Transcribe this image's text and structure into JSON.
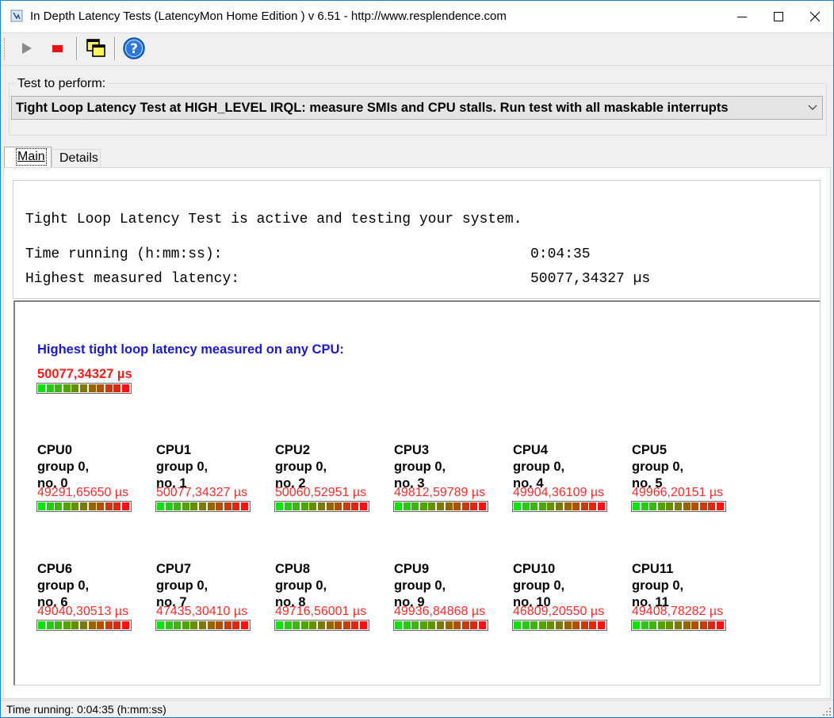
{
  "window": {
    "title": "In Depth Latency Tests  (LatencyMon Home Edition )  v 6.51 - http://www.resplendence.com"
  },
  "toolbar": {
    "icons": [
      "play-icon",
      "stop-icon",
      "windows-icon",
      "help-icon"
    ]
  },
  "test": {
    "group_label": "Test to perform:",
    "selected": "Tight Loop Latency Test at HIGH_LEVEL IRQL:  measure SMIs and CPU stalls. Run test with all maskable interrupts"
  },
  "tabs": [
    {
      "label": "Main"
    },
    {
      "label": "Details"
    }
  ],
  "summary": {
    "status": "Tight Loop Latency Test is active and testing your system.",
    "time_label": "Time running (h:mm:ss):",
    "time_value": "0:04:35",
    "latency_label": "Highest measured latency:",
    "latency_value": "50077,34327 µs"
  },
  "highest": {
    "label": "Highest tight loop latency measured on any CPU:",
    "value": "50077,34327 µs",
    "bar_level": 1.0
  },
  "cpus": [
    {
      "name": "CPU0",
      "group": "group 0,",
      "no": "no. 0",
      "value": "49291,65650 µs"
    },
    {
      "name": "CPU1",
      "group": "group 0,",
      "no": "no. 1",
      "value": "50077,34327 µs"
    },
    {
      "name": "CPU2",
      "group": "group 0,",
      "no": "no. 2",
      "value": "50060,52951 µs"
    },
    {
      "name": "CPU3",
      "group": "group 0,",
      "no": "no. 3",
      "value": "49812,59789 µs"
    },
    {
      "name": "CPU4",
      "group": "group 0,",
      "no": "no. 4",
      "value": "49904,36109 µs"
    },
    {
      "name": "CPU5",
      "group": "group 0,",
      "no": "no. 5",
      "value": "49966,20151 µs"
    },
    {
      "name": "CPU6",
      "group": "group 0,",
      "no": "no. 6",
      "value": "49040,30513 µs"
    },
    {
      "name": "CPU7",
      "group": "group 0,",
      "no": "no. 7",
      "value": "47435,30410 µs"
    },
    {
      "name": "CPU8",
      "group": "group 0,",
      "no": "no. 8",
      "value": "49716,56001 µs"
    },
    {
      "name": "CPU9",
      "group": "group 0,",
      "no": "no. 9",
      "value": "49936,84868 µs"
    },
    {
      "name": "CPU10",
      "group": "group 0,",
      "no": "no. 10",
      "value": "46809,20550 µs"
    },
    {
      "name": "CPU11",
      "group": "group 0,",
      "no": "no. 11",
      "value": "49408,78282 µs"
    }
  ],
  "statusbar": {
    "text": "Time running: 0:04:35  (h:mm:ss)"
  },
  "colors": {
    "value_red": "#ff2a2a",
    "label_blue": "#1a1ad0",
    "bar_green": "#10e010",
    "bar_red": "#ff1010",
    "window_border": "#1883d7"
  }
}
